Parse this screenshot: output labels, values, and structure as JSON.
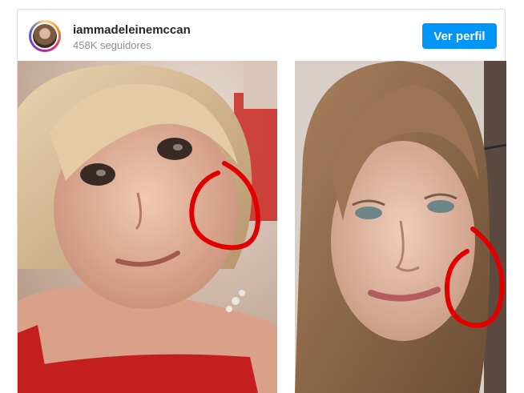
{
  "post": {
    "username": "iammadeleinemccan",
    "followers": "458K seguidores",
    "profile_button": "Ver perfil"
  },
  "icons": {
    "avatar": "profile-avatar",
    "annotation": "red-circle-annotation"
  },
  "colors": {
    "button_bg": "#0095f6",
    "annotation_red": "#e00000",
    "border": "#dbdbdb"
  }
}
